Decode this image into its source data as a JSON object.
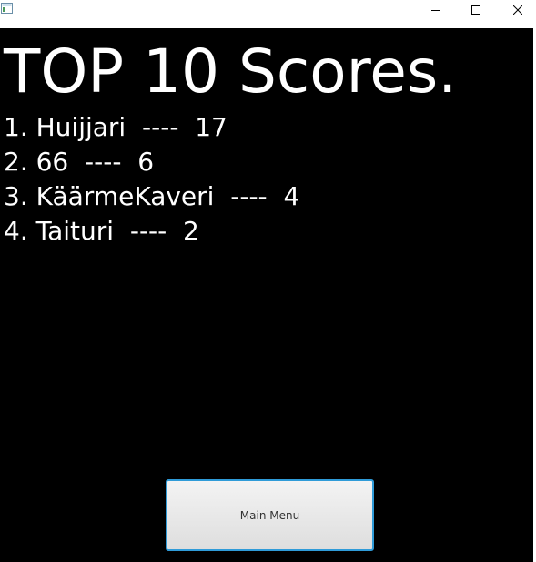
{
  "window": {
    "controls": {
      "minimize_icon": "minimize-icon",
      "maximize_icon": "maximize-icon",
      "close_icon": "close-icon"
    }
  },
  "screen": {
    "title": "TOP 10 Scores.",
    "scores": [
      "1. Huijjari  ----  17",
      "2. 66  ----  6",
      "3. KäärmeKaveri  ----  4",
      "4. Taituri  ----  2"
    ],
    "main_menu_label": "Main Menu"
  },
  "colors": {
    "background": "#000000",
    "text": "#ffffff",
    "button_border": "#2f9bd8"
  }
}
